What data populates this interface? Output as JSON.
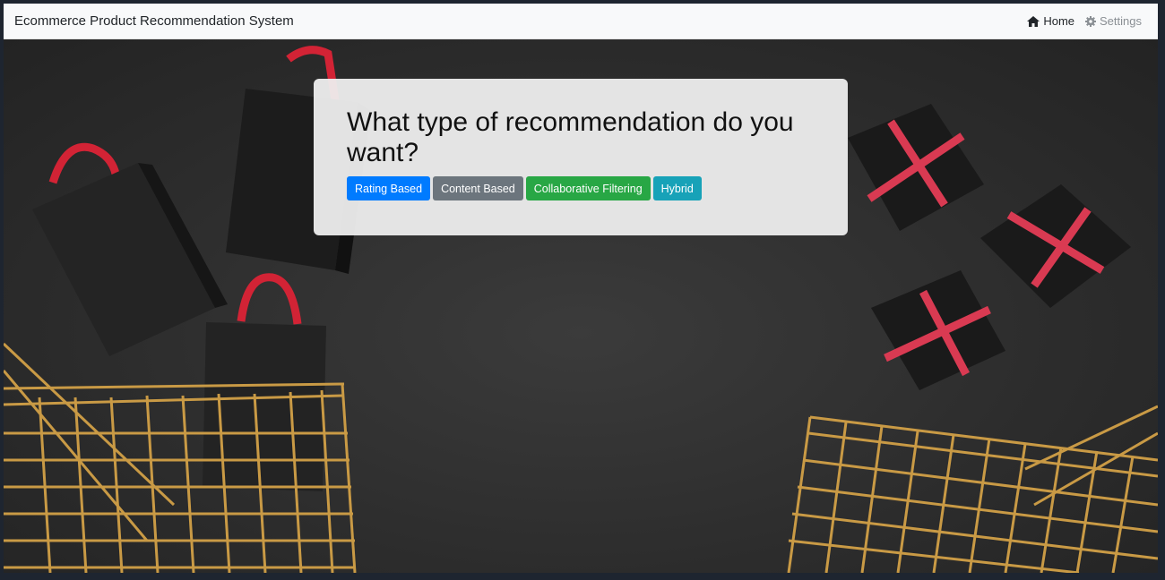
{
  "navbar": {
    "brand": "Ecommerce Product Recommendation System",
    "home_label": "Home",
    "home_icon": "home-icon",
    "settings_label": "Settings",
    "settings_icon": "gear-icon"
  },
  "card": {
    "title": "What type of recommendation do you want?",
    "buttons": [
      {
        "label": "Rating Based",
        "color": "#007bff"
      },
      {
        "label": "Content Based",
        "color": "#6c757d"
      },
      {
        "label": "Collaborative Filtering",
        "color": "#28a745"
      },
      {
        "label": "Hybrid",
        "color": "#17a2b8"
      }
    ]
  },
  "colors": {
    "navbar_bg": "#f8f9fa",
    "hero_bg": "#2d2d2d",
    "ribbon": "#c8283a",
    "gold": "#c99a45"
  }
}
